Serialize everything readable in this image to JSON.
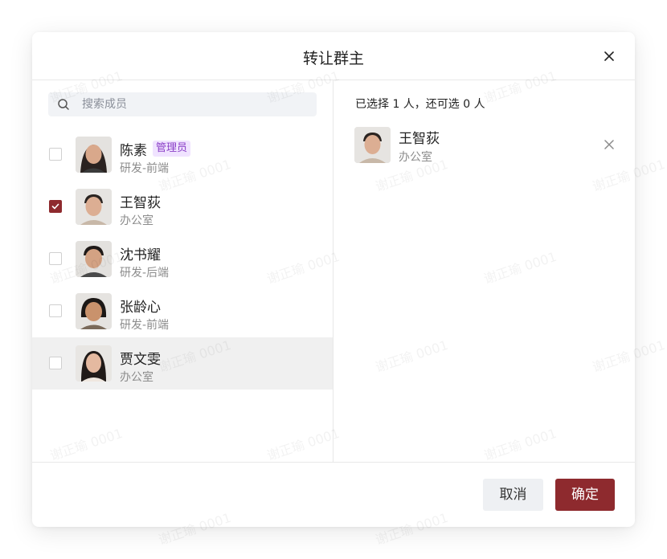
{
  "dialog": {
    "title": "转让群主",
    "close_icon": "close-icon"
  },
  "search": {
    "placeholder": "搜索成员",
    "value": ""
  },
  "members": [
    {
      "name": "陈素",
      "dept": "研发-前端",
      "badge": "管理员",
      "checked": false
    },
    {
      "name": "王智荻",
      "dept": "办公室",
      "badge": "",
      "checked": true
    },
    {
      "name": "沈书耀",
      "dept": "研发-后端",
      "badge": "",
      "checked": false
    },
    {
      "name": "张龄心",
      "dept": "研发-前端",
      "badge": "",
      "checked": false
    },
    {
      "name": "贾文雯",
      "dept": "办公室",
      "badge": "",
      "checked": false,
      "hovered": true
    }
  ],
  "selection": {
    "summary": "已选择 1 人，还可选 0 人",
    "items": [
      {
        "name": "王智荻",
        "dept": "办公室"
      }
    ]
  },
  "footer": {
    "cancel_label": "取消",
    "ok_label": "确定"
  },
  "watermark": {
    "text": "谢正瑜 0001"
  },
  "colors": {
    "accent": "#8e2a2e",
    "badge_bg": "#f0e3ff",
    "badge_text": "#8a3fc7",
    "hover_row": "#f0f0f0"
  }
}
